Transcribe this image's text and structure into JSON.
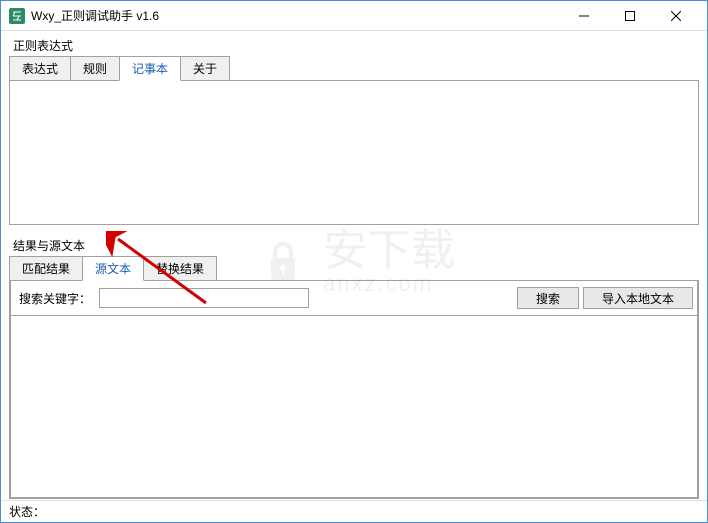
{
  "window": {
    "title": "Wxy_正则调试助手  v1.6"
  },
  "top_section": {
    "group_label": "正则表达式",
    "tabs": [
      "表达式",
      "规则",
      "记事本",
      "关于"
    ],
    "active_tab_index": 2,
    "content": ""
  },
  "results_section": {
    "group_label": "结果与源文本",
    "tabs": [
      "匹配结果",
      "源文本",
      "替换结果"
    ],
    "active_tab_index": 1,
    "search_label": "搜索关键字：",
    "search_value": "",
    "search_button": "搜索",
    "import_button": "导入本地文本",
    "content": ""
  },
  "status_bar": {
    "label": "状态："
  },
  "watermark": {
    "main": "安下载",
    "sub": "anxz.com"
  }
}
